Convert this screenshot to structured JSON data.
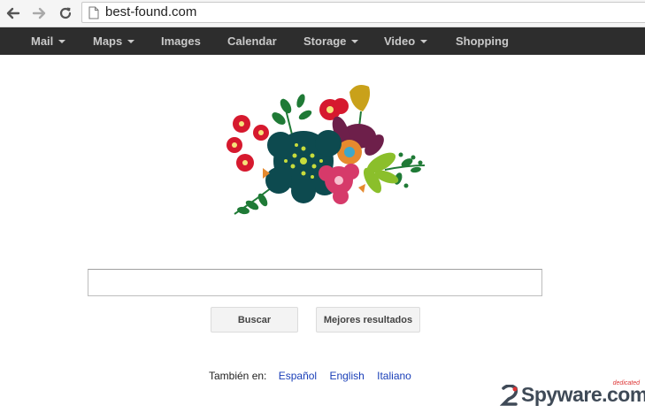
{
  "browser": {
    "url": "best-found.com"
  },
  "topnav": {
    "items": [
      {
        "label": "Mail",
        "dropdown": true
      },
      {
        "label": "Maps",
        "dropdown": true
      },
      {
        "label": "Images",
        "dropdown": false
      },
      {
        "label": "Calendar",
        "dropdown": false
      },
      {
        "label": "Storage",
        "dropdown": true
      },
      {
        "label": "Video",
        "dropdown": true
      },
      {
        "label": "Shopping",
        "dropdown": false
      }
    ]
  },
  "logo": {
    "icon": "flower-bouquet-icon"
  },
  "search": {
    "value": "",
    "search_label": "Buscar",
    "best_results_label": "Mejores resultados"
  },
  "languages": {
    "prefix": "También en:",
    "links": [
      "Español",
      "English",
      "Italiano"
    ]
  },
  "watermark": {
    "text": "Spyware.com",
    "sub": "dedicated"
  },
  "colors": {
    "nav_bg": "#2d2d2d",
    "nav_text": "#c9c9c9",
    "link": "#1a3fb8",
    "button_bg": "#f3f3f3"
  }
}
